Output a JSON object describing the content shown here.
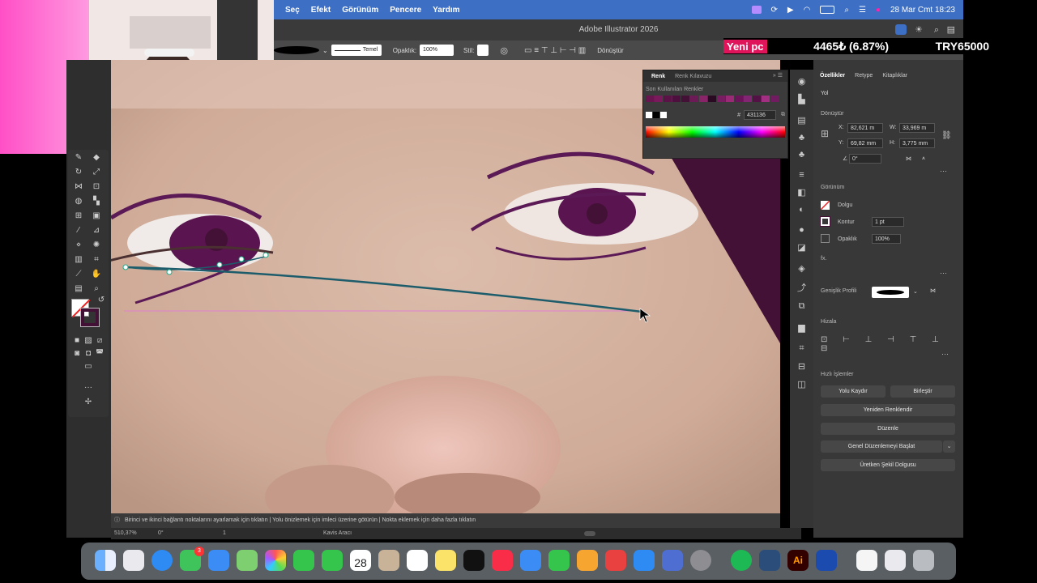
{
  "menubar": {
    "items": [
      "Seç",
      "Efekt",
      "Görünüm",
      "Pencere",
      "Yardım"
    ],
    "datetime": "28 Mar Cmt  18:23"
  },
  "titlebar": {
    "title": "Adobe Illustrator 2026"
  },
  "controlbar": {
    "stroke_style": "Temel",
    "opacity_label": "Opaklık:",
    "opacity_value": "100%",
    "style_label": "Stil:",
    "transform_label": "Dönüştür"
  },
  "ticker": {
    "tag": "Yeni pc",
    "value": "4465₺ (6.87%)",
    "goal": "TRY65000"
  },
  "color_panel": {
    "tabs": [
      "Renk",
      "Renk Kılavuzu"
    ],
    "recent_label": "Son Kullanılan Renkler",
    "hex_value": "431136",
    "swatches": [
      "#6a1550",
      "#7a1a5c",
      "#5b1247",
      "#4d0f3d",
      "#431136",
      "#6d1b57",
      "#8a2468",
      "#2a0a22",
      "#791d63",
      "#9b2a76",
      "#6c145a",
      "#842574",
      "#531145",
      "#a32f82",
      "#711b60"
    ]
  },
  "properties": {
    "tabs": [
      "Özellikler",
      "Retype",
      "Kitaplıklar"
    ],
    "object_type": "Yol",
    "transform_title": "Dönüştür",
    "x_label": "X:",
    "x_value": "82,621 m",
    "y_label": "Y:",
    "y_value": "69,82 mm",
    "w_label": "W:",
    "w_value": "33,969 m",
    "h_label": "H:",
    "h_value": "3,775 mm",
    "angle_value": "0°",
    "appearance_title": "Görünüm",
    "fill_label": "Dolgu",
    "stroke_label": "Kontur",
    "stroke_value": "1 pt",
    "opacity_label": "Opaklık",
    "opacity_value": "100%",
    "fx_label": "fx.",
    "width_profile_label": "Genişlik Profili",
    "align_title": "Hizala",
    "quick_actions_title": "Hızlı İşlemler",
    "btn_save_path": "Yolu Kaydır",
    "btn_merge": "Birleştir",
    "btn_recolor": "Yeniden Renklendir",
    "btn_arrange": "Düzenle",
    "btn_global_edit": "Genel Düzenlemeyi Başlat",
    "btn_generative_fill": "Üretken Şekil Dolgusu"
  },
  "status": {
    "hint": "Birinci ve ikinci bağlantı noktalarını ayarlamak için tıklatın  |  Yolu önizlemek için imleci üzerine götürün  |  Nokta eklemek için daha fazla tıklatın",
    "zoom": "510,37%",
    "rotate": "0°",
    "artboard": "1",
    "tool": "Kavis Aracı"
  },
  "dock": {
    "calendar_day": "28",
    "messages_badge": "3",
    "icons": [
      "finder-icon",
      "launchpad-icon",
      "safari-icon",
      "messages-icon",
      "mail-icon",
      "maps-icon",
      "photos-icon",
      "facetime-icon",
      "phone-icon",
      "calendar-icon",
      "contacts-icon",
      "reminders-icon",
      "notes-icon",
      "tv-icon",
      "music-icon",
      "keynote-icon",
      "numbers-icon",
      "pages-icon",
      "rocket-icon",
      "appstore-icon",
      "preview-icon",
      "settings-icon",
      "spotify-icon",
      "finder-drive-icon",
      "illustrator-icon",
      "vpn-icon",
      "document-icon",
      "screen-icon",
      "trash-icon"
    ]
  },
  "colors": {
    "accent_purple": "#431136",
    "menubar": "#3d6fc4"
  }
}
